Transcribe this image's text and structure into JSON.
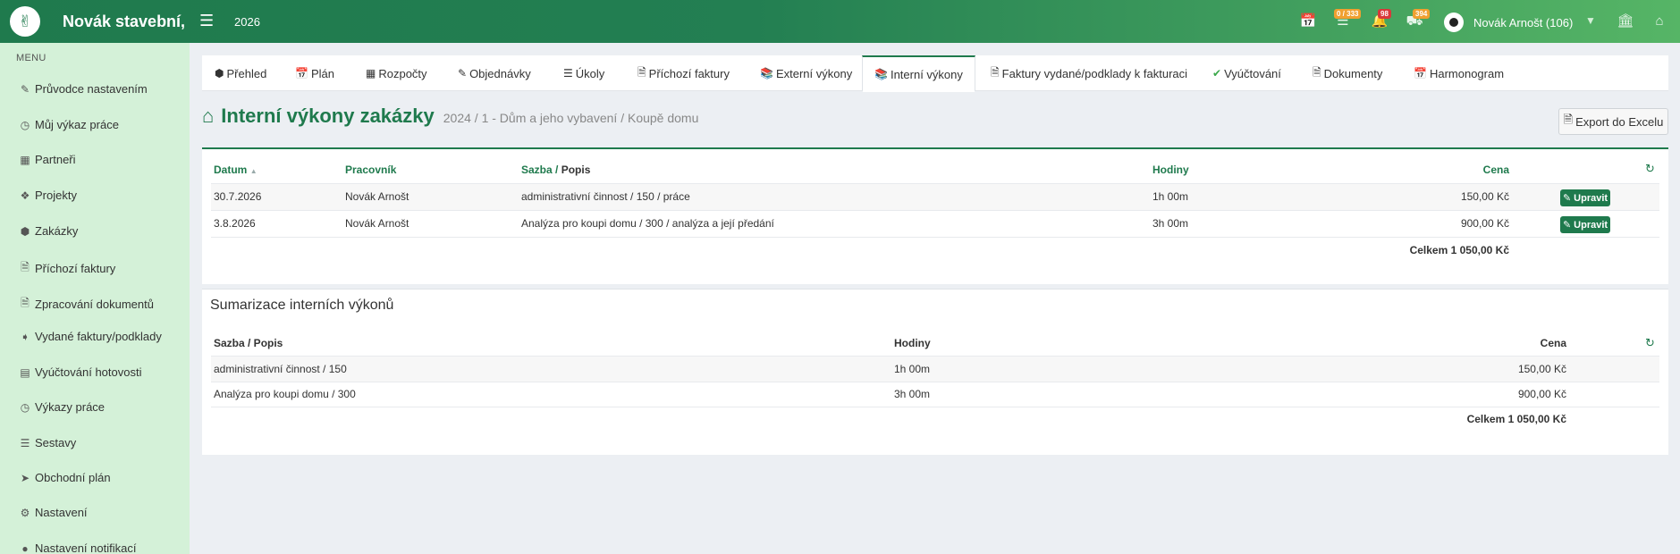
{
  "header": {
    "brand": "Novák stavební,",
    "year": "2026",
    "badges": {
      "tasks": "0 / 333",
      "notifications": "98",
      "deliveries": "394"
    },
    "user": "Novák Arnošt (106)"
  },
  "sidebar": {
    "menu_label": "MENU",
    "items": [
      {
        "label": "Průvodce nastavením",
        "icon": "pencil-icon"
      },
      {
        "label": "Můj výkaz práce",
        "icon": "clock-icon"
      },
      {
        "label": "Partneři",
        "icon": "building-icon"
      },
      {
        "label": "Projekty",
        "icon": "cubes-icon"
      },
      {
        "label": "Zakázky",
        "icon": "cube-icon"
      },
      {
        "label": "Příchozí faktury",
        "icon": "file-icon"
      },
      {
        "label": "Zpracování dokumentů",
        "icon": "file-icon"
      },
      {
        "label": "Vydané faktury/podklady",
        "icon": "file-export-icon"
      },
      {
        "label": "Vyúčtování hotovosti",
        "icon": "money-icon"
      },
      {
        "label": "Výkazy práce",
        "icon": "clock-icon"
      },
      {
        "label": "Sestavy",
        "icon": "chart-icon"
      },
      {
        "label": "Obchodní plán",
        "icon": "paper-plane-icon"
      },
      {
        "label": "Nastavení",
        "icon": "cogs-icon"
      },
      {
        "label": "Nastavení notifikací",
        "icon": "bell-icon"
      }
    ]
  },
  "tabs": [
    {
      "label": "Přehled",
      "icon": "cube-icon"
    },
    {
      "label": "Plán",
      "icon": "calendar-icon"
    },
    {
      "label": "Rozpočty",
      "icon": "calculator-icon"
    },
    {
      "label": "Objednávky",
      "icon": "edit-icon"
    },
    {
      "label": "Úkoly",
      "icon": "list-icon"
    },
    {
      "label": "Příchozí faktury",
      "icon": "invoice-icon"
    },
    {
      "label": "Externí výkony",
      "icon": "books-icon"
    },
    {
      "label": "Interní výkony",
      "icon": "books-icon"
    },
    {
      "label": "Faktury vydané/podklady k fakturaci",
      "icon": "invoice-out-icon"
    },
    {
      "label": "Vyúčtování",
      "icon": "check-icon"
    },
    {
      "label": "Dokumenty",
      "icon": "document-icon"
    },
    {
      "label": "Harmonogram",
      "icon": "calendar-icon"
    }
  ],
  "page": {
    "title": "Interní výkony zakázky",
    "subtitle": "2024 / 1 - Dům a jeho vybavení / Koupě domu",
    "export_label": "Export do Excelu"
  },
  "table": {
    "headers": {
      "date": "Datum",
      "worker": "Pracovník",
      "rate_a": "Sazba",
      "rate_sep": " / ",
      "rate_b": "Popis",
      "hours": "Hodiny",
      "price": "Cena"
    },
    "rows": [
      {
        "date": "30.7.2026",
        "worker": "Novák Arnošt",
        "desc": "administrativní činnost / 150 / práce",
        "hours": "1h 00m",
        "price": "150,00 Kč",
        "action": "Upravit"
      },
      {
        "date": "3.8.2026",
        "worker": "Novák Arnošt",
        "desc": "Analýza pro koupi domu / 300 / analýza a její předání",
        "hours": "3h 00m",
        "price": "900,00 Kč",
        "action": "Upravit"
      }
    ],
    "total": "Celkem 1 050,00 Kč"
  },
  "summary": {
    "title": "Sumarizace interních výkonů",
    "headers": {
      "rate": "Sazba / Popis",
      "hours": "Hodiny",
      "price": "Cena"
    },
    "rows": [
      {
        "desc": "administrativní činnost / 150",
        "hours": "1h 00m",
        "price": "150,00 Kč"
      },
      {
        "desc": "Analýza pro koupi domu / 300",
        "hours": "3h 00m",
        "price": "900,00 Kč"
      }
    ],
    "total": "Celkem 1 050,00 Kč"
  },
  "colors": {
    "primary": "#1f7a4d",
    "sidebar": "#d4f1d8",
    "badge_orange": "#f0a030",
    "badge_red": "#d9383a"
  }
}
